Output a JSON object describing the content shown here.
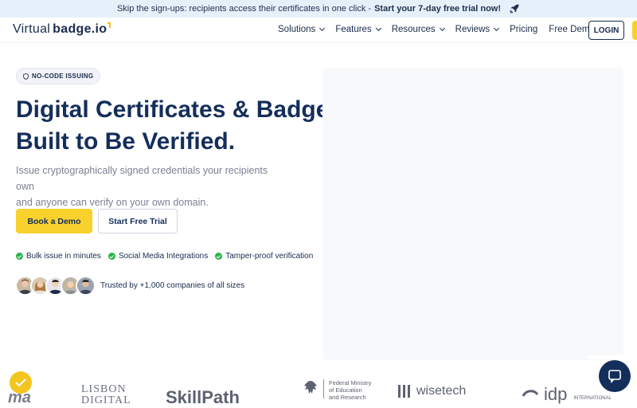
{
  "announcement": {
    "text": "Skip the sign-ups: recipients access their certificates in one click -",
    "cta": "Start your 7-day free trial now!"
  },
  "nav": {
    "logo_light": "Virtual",
    "logo_bold": "badge.io",
    "items": [
      {
        "label": "Solutions",
        "dropdown": true
      },
      {
        "label": "Features",
        "dropdown": true
      },
      {
        "label": "Resources",
        "dropdown": true
      },
      {
        "label": "Reviews",
        "dropdown": true
      },
      {
        "label": "Pricing",
        "dropdown": false
      },
      {
        "label": "Free Demo",
        "dropdown": false
      }
    ],
    "login": "LOGIN"
  },
  "hero": {
    "badge": "NO-CODE ISSUING",
    "title_line1": "Digital Certificates & Badges,",
    "title_line2": "Built to Be Verified.",
    "subtitle_line1": "Issue cryptographically signed credentials your recipients own",
    "subtitle_line2": "and anyone can verify on your own domain.",
    "btn_demo": "Book a Demo",
    "btn_trial": "Start Free Trial",
    "features": [
      "Bulk issue in minutes",
      "Social Media Integrations",
      "Tamper-proof verification"
    ],
    "trusted": "Trusted by +1,000 companies of all sizes"
  },
  "logos": {
    "lisbon": "LISBON",
    "lisbon2": "DIGITAL",
    "skillpath": "SkillPath",
    "ministry1": "Federal Ministry",
    "ministry2": "of Education",
    "ministry3": "and Research",
    "wisetech": "wisetech",
    "idp": "idp",
    "idp_small": "INTERNATIONAL"
  },
  "colors": {
    "brand_navy": "#142e5b",
    "accent_yellow": "#f8d12c",
    "check_green": "#27b34b",
    "announce_bg": "#e6f0fb"
  },
  "icons": [
    "rocket-icon",
    "chevron-down-icon",
    "shield-icon",
    "check-icon",
    "chat-icon"
  ]
}
